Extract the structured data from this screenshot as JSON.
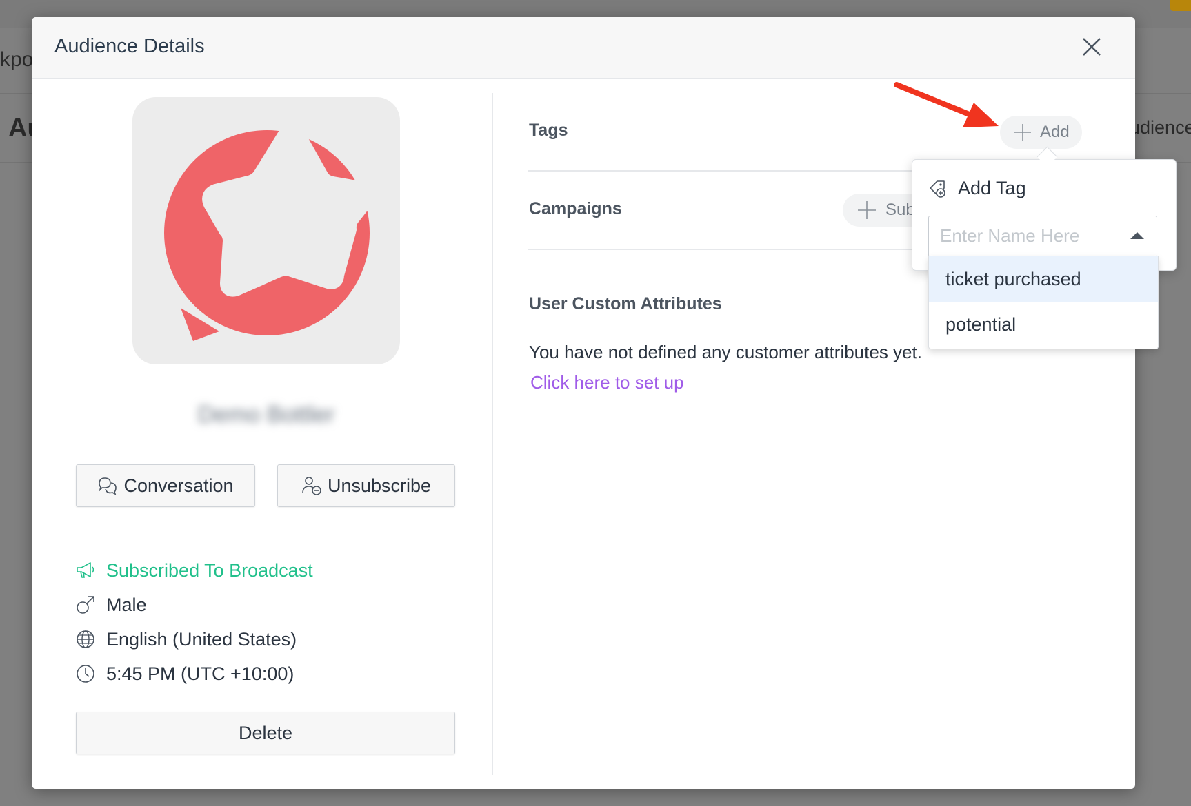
{
  "background": {
    "left_fragment_1": "kpo",
    "left_fragment_2": "Au",
    "right_fragment": "udience"
  },
  "modal": {
    "title": "Audience Details",
    "close_icon": "close-icon"
  },
  "profile": {
    "name_blurred": "Demo Bottler",
    "avatar_icon": "star-chat-bubble-logo",
    "avatar_color": "#ef6468"
  },
  "actions": {
    "conversation_label": "Conversation",
    "conversation_icon": "chat-bubbles-icon",
    "unsubscribe_label": "Unsubscribe",
    "unsubscribe_icon": "user-minus-icon",
    "delete_label": "Delete"
  },
  "info": {
    "subscription": "Subscribed To Broadcast",
    "subscription_color": "#21c08b",
    "gender": "Male",
    "language": "English (United States)",
    "time": "5:45 PM (UTC +10:00)"
  },
  "tags": {
    "label": "Tags",
    "add_label": "Add"
  },
  "campaigns": {
    "label": "Campaigns",
    "subscribe_label": "Sub"
  },
  "custom_attributes": {
    "label": "User Custom Attributes",
    "empty_text": "You have not defined any customer attributes yet.",
    "setup_link": "Click here to set up",
    "link_color": "#a05ce8"
  },
  "add_tag_popover": {
    "title": "Add Tag",
    "input_placeholder": "Enter Name Here",
    "input_value": "",
    "options": [
      "ticket purchased",
      "potential"
    ],
    "highlighted_option": "ticket purchased"
  },
  "annotation": {
    "arrow_color": "#f0341f"
  }
}
